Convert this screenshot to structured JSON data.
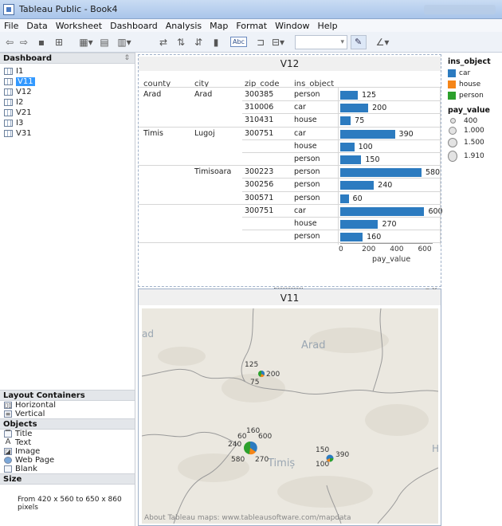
{
  "window": {
    "title": "Tableau Public - Book4"
  },
  "menu": [
    "File",
    "Data",
    "Worksheet",
    "Dashboard",
    "Analysis",
    "Map",
    "Format",
    "Window",
    "Help"
  ],
  "toolbar": {
    "abc_label": "Abc"
  },
  "dashboard_panel": {
    "header": "Dashboard",
    "sheets": [
      {
        "label": "I1",
        "selected": false
      },
      {
        "label": "V11",
        "selected": true
      },
      {
        "label": "V12",
        "selected": false
      },
      {
        "label": "I2",
        "selected": false
      },
      {
        "label": "V21",
        "selected": false
      },
      {
        "label": "I3",
        "selected": false
      },
      {
        "label": "V31",
        "selected": false
      }
    ]
  },
  "layout_containers": {
    "header": "Layout Containers",
    "items": [
      "Horizontal",
      "Vertical"
    ]
  },
  "objects": {
    "header": "Objects",
    "items": [
      "Title",
      "Text",
      "Image",
      "Web Page",
      "Blank"
    ]
  },
  "size": {
    "header": "Size",
    "text": "From 420 x 560 to 650 x 860 pixels"
  },
  "v12": {
    "title": "V12",
    "columns": [
      "county",
      "city",
      "zip_code",
      "ins_object"
    ],
    "rows": [
      {
        "county": "Arad",
        "city": "Arad",
        "zip": "300385",
        "obj": "person",
        "value": 125
      },
      {
        "county": "",
        "city": "",
        "zip": "310006",
        "obj": "car",
        "value": 200
      },
      {
        "county": "",
        "city": "",
        "zip": "310431",
        "obj": "house",
        "value": 75
      },
      {
        "county": "Timis",
        "city": "Lugoj",
        "zip": "300751",
        "obj": "car",
        "value": 390
      },
      {
        "county": "",
        "city": "",
        "zip": "",
        "obj": "house",
        "value": 100
      },
      {
        "county": "",
        "city": "",
        "zip": "",
        "obj": "person",
        "value": 150
      },
      {
        "county": "",
        "city": "Timisoara",
        "zip": "300223",
        "obj": "person",
        "value": 580
      },
      {
        "county": "",
        "city": "",
        "zip": "300256",
        "obj": "person",
        "value": 240
      },
      {
        "county": "",
        "city": "",
        "zip": "300571",
        "obj": "person",
        "value": 60
      },
      {
        "county": "",
        "city": "",
        "zip": "300751",
        "obj": "car",
        "value": 600
      },
      {
        "county": "",
        "city": "",
        "zip": "",
        "obj": "house",
        "value": 270
      },
      {
        "county": "",
        "city": "",
        "zip": "",
        "obj": "person",
        "value": 160
      }
    ],
    "axis": {
      "ticks": [
        0,
        200,
        400,
        600
      ],
      "max": 660,
      "title": "pay_value"
    },
    "bar_color": "#2c7bc0"
  },
  "v11": {
    "title": "V11",
    "map_labels": {
      "region1": "Arad",
      "region2": "Timiș",
      "partial_left": "ad",
      "partial_right": "H"
    },
    "credit": "About Tableau maps: www.tableausoftware.com/mapdata",
    "pie_labels": [
      {
        "text": "125"
      },
      {
        "text": "200"
      },
      {
        "text": "75"
      },
      {
        "text": "60"
      },
      {
        "text": "160"
      },
      {
        "text": "600"
      },
      {
        "text": "240"
      },
      {
        "text": "580"
      },
      {
        "text": "270"
      },
      {
        "text": "150"
      },
      {
        "text": "390"
      },
      {
        "text": "100"
      }
    ]
  },
  "legend": {
    "color_title": "ins_object",
    "colors": [
      {
        "label": "car",
        "color": "#2c7bc0"
      },
      {
        "label": "house",
        "color": "#f58518"
      },
      {
        "label": "person",
        "color": "#2ca02c"
      }
    ],
    "size_title": "pay_value",
    "sizes": [
      "400",
      "1.000",
      "1.500",
      "1.910"
    ]
  }
}
